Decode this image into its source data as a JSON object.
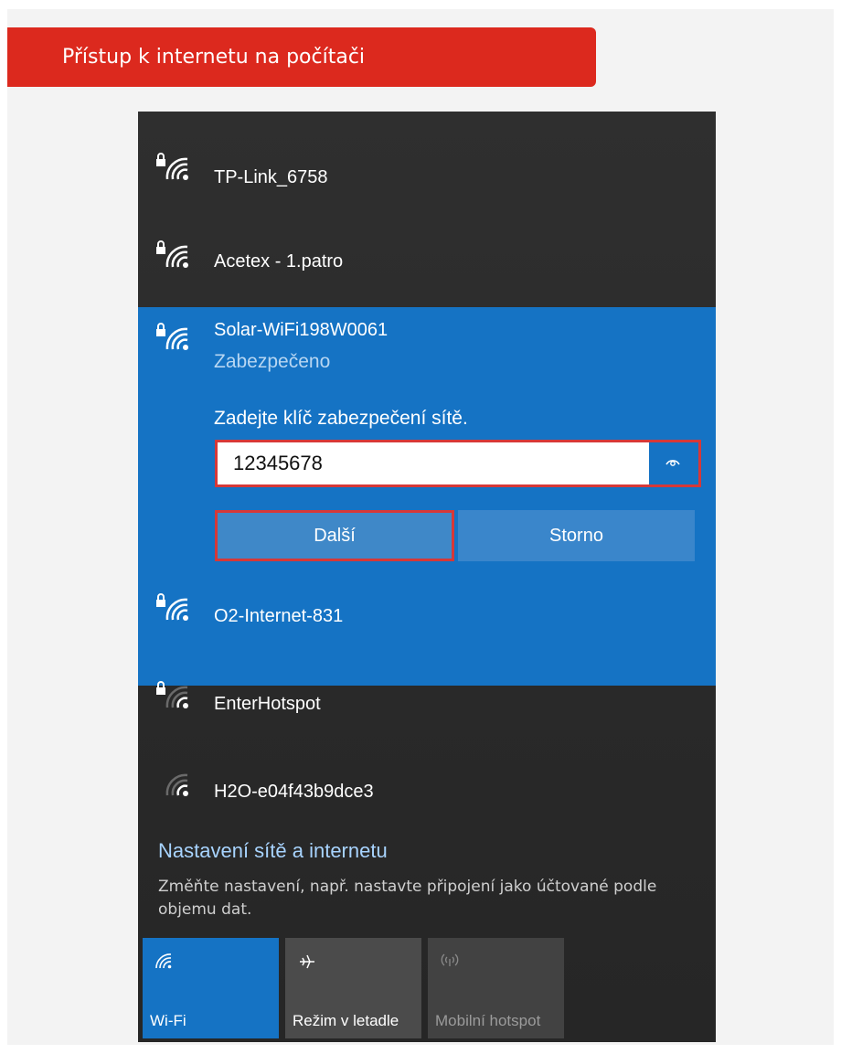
{
  "banner": {
    "title": "Přístup k internetu na počítači"
  },
  "networks_top": [
    {
      "name": "TP-Link_6758",
      "secured": true
    },
    {
      "name": "Acetex - 1.patro",
      "secured": true
    }
  ],
  "selected_network": {
    "name": "Solar-WiFi198W0061",
    "status": "Zabezpečeno",
    "prompt": "Zadejte klíč zabezpečení sítě.",
    "password_value": "12345678",
    "next_label": "Další",
    "cancel_label": "Storno"
  },
  "networks_bottom": [
    {
      "name": "O2-Internet-831",
      "secured": true
    },
    {
      "name": "EnterHotspot",
      "secured": true
    },
    {
      "name": "H2O-e04f43b9dce3",
      "secured": false
    }
  ],
  "settings": {
    "title": "Nastavení sítě a internetu",
    "description": "Změňte nastavení, např. nastavte připojení jako účtované podle objemu dat."
  },
  "tiles": [
    {
      "label": "Wi-Fi",
      "icon": "wifi-icon",
      "active": true
    },
    {
      "label": "Režim v letadle",
      "icon": "airplane-icon",
      "active": false
    },
    {
      "label": "Mobilní hotspot",
      "icon": "hotspot-icon",
      "active": false,
      "disabled": true
    }
  ],
  "colors": {
    "banner": "#dc291e",
    "accent": "#1573c4",
    "highlight_border": "#d63838",
    "panel_bg": "#2b2b2b",
    "link": "#a8d4ff"
  }
}
